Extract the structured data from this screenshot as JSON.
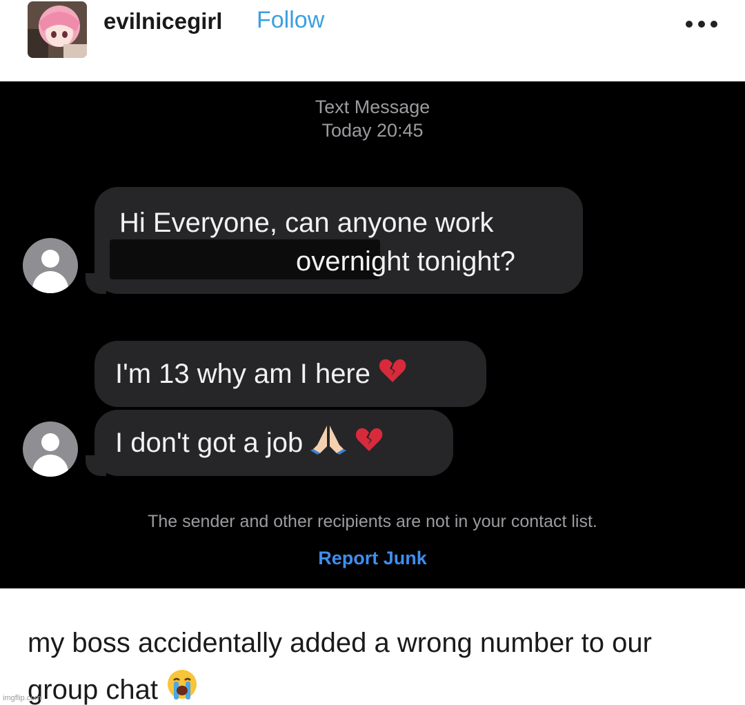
{
  "post": {
    "username": "evilnicegirl",
    "follow_label": "Follow",
    "more_icon": "more-options-icon"
  },
  "screenshot": {
    "title": "Text Message",
    "date": "Today 20:45",
    "messages": [
      {
        "line1": "Hi Everyone, can anyone work",
        "line2": "overnight tonight?"
      },
      {
        "text": "I'm 13 why am I here",
        "emojis": [
          "broken-heart-icon"
        ]
      },
      {
        "text": "I don't got a job",
        "emojis": [
          "folded-hands-icon",
          "broken-heart-icon"
        ]
      }
    ],
    "notice": "The sender and other recipients are not in your contact list.",
    "report_label": "Report Junk"
  },
  "caption": {
    "text": "my boss accidentally added a wrong number to our group chat",
    "emoji": "loudly-crying-face-icon"
  },
  "watermark": "imgflip.com",
  "colors": {
    "follow": "#3b9fe0",
    "bubble": "#262628",
    "panel_bg": "#000000",
    "report": "#3f8ef0"
  }
}
